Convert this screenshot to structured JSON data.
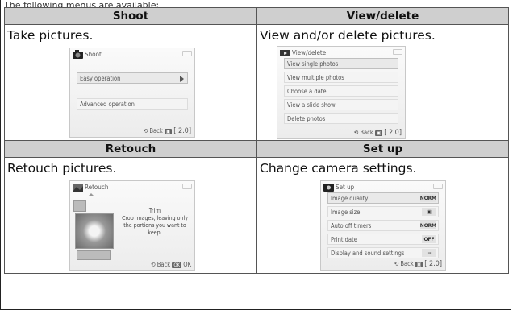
{
  "intro_text": "The following menus are available:",
  "cells": [
    {
      "header": "Shoot",
      "description": "Take pictures.",
      "screen": {
        "title": "Shoot",
        "items": [
          {
            "label": "Easy operation",
            "value": "",
            "selected": true,
            "arrow": true
          },
          {
            "label": "Advanced operation",
            "value": "",
            "selected": false,
            "arrow": false
          }
        ],
        "footer": {
          "back": "Back",
          "zoom": "2.0"
        }
      }
    },
    {
      "header": "View/delete",
      "description": "View and/or delete pictures.",
      "screen": {
        "title": "View/delete",
        "items": [
          {
            "label": "View single photos"
          },
          {
            "label": "View multiple photos"
          },
          {
            "label": "Choose a date"
          },
          {
            "label": "View a slide show"
          },
          {
            "label": "Delete photos"
          }
        ],
        "footer": {
          "back": "Back",
          "zoom": "2.0"
        }
      }
    },
    {
      "header": "Retouch",
      "description": "Retouch pictures.",
      "screen": {
        "title": "Retouch",
        "option_title": "Trim",
        "option_text": "Crop images, leaving only the portions you want to keep.",
        "footer": {
          "back": "Back",
          "ok": "OK"
        }
      }
    },
    {
      "header": "Set up",
      "description": "Change camera settings.",
      "screen": {
        "title": "Set up",
        "items": [
          {
            "label": "Image quality",
            "value": "NORM"
          },
          {
            "label": "Image size",
            "value": "▣"
          },
          {
            "label": "Auto off timers",
            "value": "NORM"
          },
          {
            "label": "Print date",
            "value": "OFF"
          },
          {
            "label": "Display and sound settings",
            "value": "--"
          }
        ],
        "footer": {
          "back": "Back",
          "zoom": "2.0"
        }
      }
    }
  ]
}
